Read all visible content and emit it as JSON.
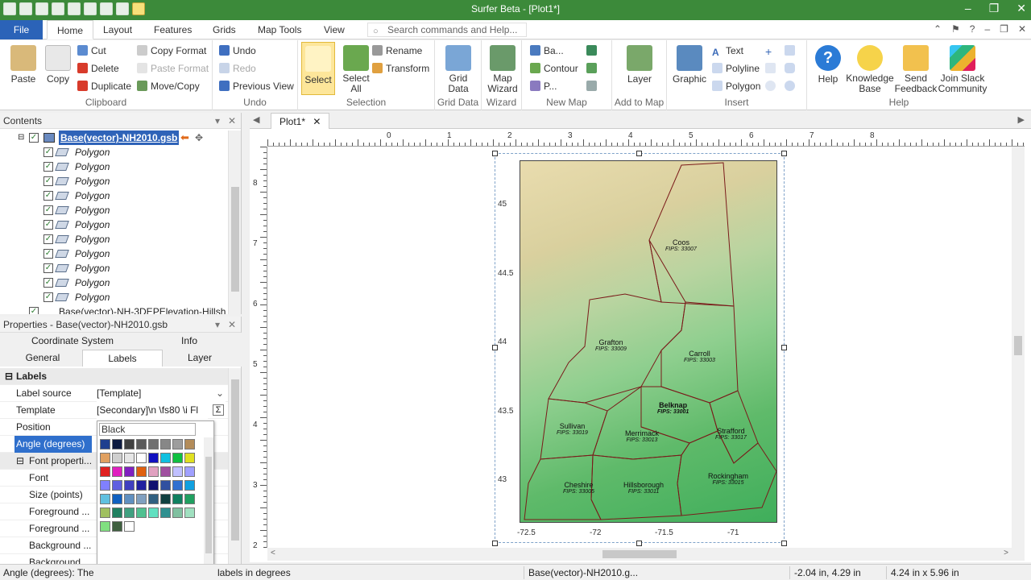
{
  "app": {
    "title": "Surfer Beta - [Plot1*]"
  },
  "ribbon_tabs": {
    "file": "File",
    "items": [
      "Home",
      "Layout",
      "Features",
      "Grids",
      "Map Tools",
      "View"
    ],
    "search_placeholder": "Search commands and Help..."
  },
  "ribbon": {
    "clipboard": {
      "label": "Clipboard",
      "paste": "Paste",
      "copy": "Copy",
      "cut": "Cut",
      "delete": "Delete",
      "duplicate": "Duplicate",
      "copy_format": "Copy Format",
      "paste_format": "Paste Format",
      "move_copy": "Move/Copy"
    },
    "undo": {
      "label": "Undo",
      "undo": "Undo",
      "redo": "Redo",
      "previous_view": "Previous View"
    },
    "selection": {
      "label": "Selection",
      "select": "Select",
      "select_all": "Select All",
      "rename": "Rename",
      "transform": "Transform"
    },
    "grid_data": {
      "label": "Grid Data",
      "grid_data": "Grid Data"
    },
    "wizard": {
      "label": "Wizard",
      "map_wizard": "Map Wizard"
    },
    "new_map": {
      "label": "New Map",
      "base": "Ba...",
      "contour": "Contour",
      "post": "P..."
    },
    "add_to_map": {
      "label": "Add to Map",
      "layer": "Layer"
    },
    "insert": {
      "label": "Insert",
      "graphic": "Graphic",
      "text": "Text",
      "polyline": "Polyline",
      "polygon": "Polygon"
    },
    "help": {
      "label": "Help",
      "help": "Help",
      "knowledge_base": "Knowledge Base",
      "send_feedback": "Send Feedback",
      "join_slack": "Join Slack Community"
    }
  },
  "contents": {
    "title": "Contents",
    "base_layer": "Base(vector)-NH2010.gsb",
    "items": [
      "Polygon",
      "Polygon",
      "Polygon",
      "Polygon",
      "Polygon",
      "Polygon",
      "Polygon",
      "Polygon",
      "Polygon",
      "Polygon",
      "Polygon"
    ],
    "next_layer": "Base(vector)-NH-3DEPElevation-Hillsh"
  },
  "properties": {
    "title": "Properties - Base(vector)-NH2010.gsb",
    "tabs": {
      "coordinate_system": "Coordinate System",
      "info": "Info",
      "general": "General",
      "labels": "Labels",
      "layer": "Layer"
    },
    "section": "Labels",
    "rows": [
      {
        "key": "Label source",
        "value": "[Template]"
      },
      {
        "key": "Template",
        "value": "[Secondary]\\n \\fs80 \\i Fl"
      },
      {
        "key": "Position",
        "value": ""
      },
      {
        "key": "Angle (degrees)",
        "value": ""
      },
      {
        "key": "Font properti...",
        "value": ""
      },
      {
        "key": "Font",
        "value": ""
      },
      {
        "key": "Size (points)",
        "value": ""
      },
      {
        "key": "Foreground ...",
        "value": ""
      },
      {
        "key": "Foreground ...",
        "value": ""
      },
      {
        "key": "Background ...",
        "value": ""
      },
      {
        "key": "Background ...",
        "value": ""
      }
    ]
  },
  "palette": {
    "current": "Black",
    "colors": [
      "#1f3f8f",
      "#0d1a40",
      "#404040",
      "#5a5a5a",
      "#707070",
      "#878787",
      "#9d9d9d",
      "#b38c5a",
      "#e0a060",
      "#cfcfcf",
      "#e6e6e6",
      "#ffffff",
      "#1010c0",
      "#10c0e0",
      "#10c040",
      "#e0e020",
      "#e02020",
      "#e020c0",
      "#8020c0",
      "#e06010",
      "#e0a0c0",
      "#a050a0",
      "#c0c0ff",
      "#a0a0ff",
      "#8080ff",
      "#6060e0",
      "#4040c0",
      "#2020a0",
      "#101070",
      "#3050a0",
      "#3070d0",
      "#10a0e0",
      "#60c0e0",
      "#1060c0",
      "#6090c0",
      "#80a0c0",
      "#306080",
      "#104040",
      "#108060",
      "#20a060",
      "#a0c060",
      "#208060",
      "#40a080",
      "#50c090",
      "#60e0c0",
      "#309090",
      "#80c0a0",
      "#a0e0c0",
      "#80e080",
      "#406040",
      "#ffffff"
    ]
  },
  "plot": {
    "tab": "Plot1*",
    "ruler_top": [
      "0",
      "1",
      "2",
      "3",
      "4",
      "5",
      "6",
      "7",
      "8"
    ],
    "ruler_left": [
      "8",
      "7",
      "6",
      "5",
      "4",
      "3",
      "2"
    ],
    "y_ticks": [
      "45",
      "44.5",
      "44",
      "43.5",
      "43"
    ],
    "x_ticks": [
      "-72.5",
      "-72",
      "-71.5",
      "-71"
    ],
    "counties": [
      {
        "name": "Coos",
        "fips": "FIPS: 33007"
      },
      {
        "name": "Grafton",
        "fips": "FIPS: 33009"
      },
      {
        "name": "Carroll",
        "fips": "FIPS: 33003"
      },
      {
        "name": "Belknap",
        "fips": "FIPS: 33001"
      },
      {
        "name": "Sullivan",
        "fips": "FIPS: 33019"
      },
      {
        "name": "Merrimack",
        "fips": "FIPS: 33013"
      },
      {
        "name": "Strafford",
        "fips": "FIPS: 33017"
      },
      {
        "name": "Cheshire",
        "fips": "FIPS: 33005"
      },
      {
        "name": "Hillsborough",
        "fips": "FIPS: 33011"
      },
      {
        "name": "Rockingham",
        "fips": "FIPS: 33015"
      }
    ]
  },
  "status": {
    "help_text": "Angle (degrees): The",
    "help_text2": "labels in degrees",
    "object": "Base(vector)-NH2010.g...",
    "position": "-2.04 in, 4.29 in",
    "size": "4.24 in x 5.96 in"
  }
}
